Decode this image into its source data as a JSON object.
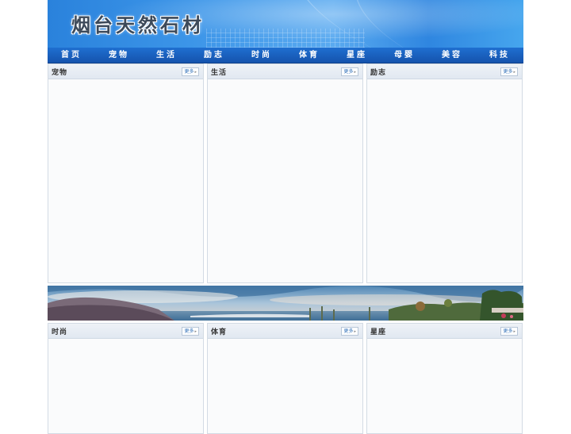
{
  "header": {
    "site_title": "烟台天然石材"
  },
  "nav": {
    "items": [
      {
        "label": "首页"
      },
      {
        "label": "宠物"
      },
      {
        "label": "生活"
      },
      {
        "label": "励志"
      },
      {
        "label": "时尚"
      },
      {
        "label": "体育"
      },
      {
        "label": "星座"
      },
      {
        "label": "母婴"
      },
      {
        "label": "美容"
      },
      {
        "label": "科技"
      }
    ]
  },
  "panels": [
    {
      "title": "宠物",
      "more_label": "更多"
    },
    {
      "title": "生活",
      "more_label": "更多"
    },
    {
      "title": "励志",
      "more_label": "更多"
    },
    {
      "title": "时尚",
      "more_label": "更多"
    },
    {
      "title": "体育",
      "more_label": "更多"
    },
    {
      "title": "星座",
      "more_label": "更多"
    }
  ],
  "colors": {
    "nav_bg": "#1a5fbf",
    "banner_blue": "#3c95e8",
    "panel_head": "#e6ecf3"
  },
  "icons": {
    "more_arrow": "chevron-right-icon"
  }
}
